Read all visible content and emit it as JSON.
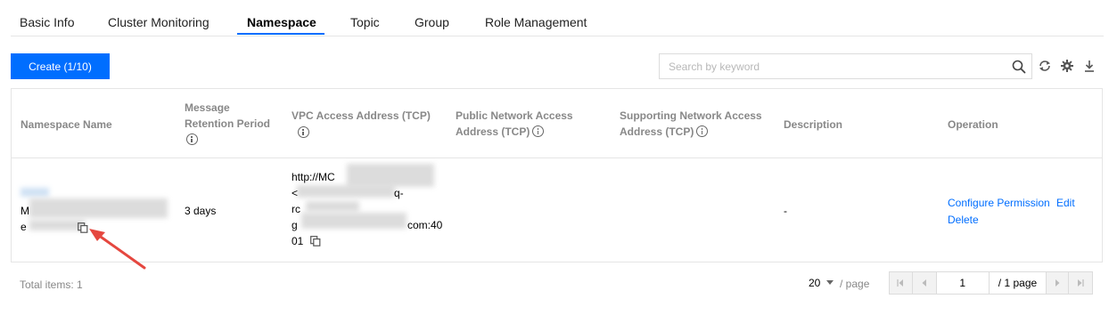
{
  "tabs": [
    {
      "label": "Basic Info"
    },
    {
      "label": "Cluster Monitoring"
    },
    {
      "label": "Namespace",
      "active": true
    },
    {
      "label": "Topic"
    },
    {
      "label": "Group"
    },
    {
      "label": "Role Management"
    }
  ],
  "toolbar": {
    "create_label": "Create (1/10)",
    "search_placeholder": "Search by keyword"
  },
  "table": {
    "headers": {
      "name": "Namespace Name",
      "retention_line1": "Message",
      "retention_line2": "Retention Period",
      "vpc": "VPC Access Address (TCP)",
      "public_line1": "Public Network Access",
      "public_line2": "Address (TCP)",
      "support_line1": "Supporting Network Access",
      "support_line2": "Address (TCP)",
      "description": "Description",
      "operation": "Operation"
    },
    "rows": [
      {
        "name_prefix1": "M",
        "name_prefix2": "e",
        "retention": "3 days",
        "vpc_line1": "http://MC",
        "vpc_line2": "<",
        "vpc_line2_tail": "q-",
        "vpc_line3": "rc",
        "vpc_line4_head": "g",
        "vpc_line4_tail": "com:40",
        "vpc_line5": "01",
        "description": "-",
        "operations": {
          "configure": "Configure Permission",
          "edit": "Edit",
          "delete": "Delete"
        }
      }
    ]
  },
  "footer": {
    "total": "Total items:  1",
    "page_size": "20",
    "per_page": "/ page",
    "current_page": "1",
    "total_pages": "/ 1 page"
  },
  "colors": {
    "accent": "#006eff",
    "annotation_arrow": "#e5473f"
  }
}
